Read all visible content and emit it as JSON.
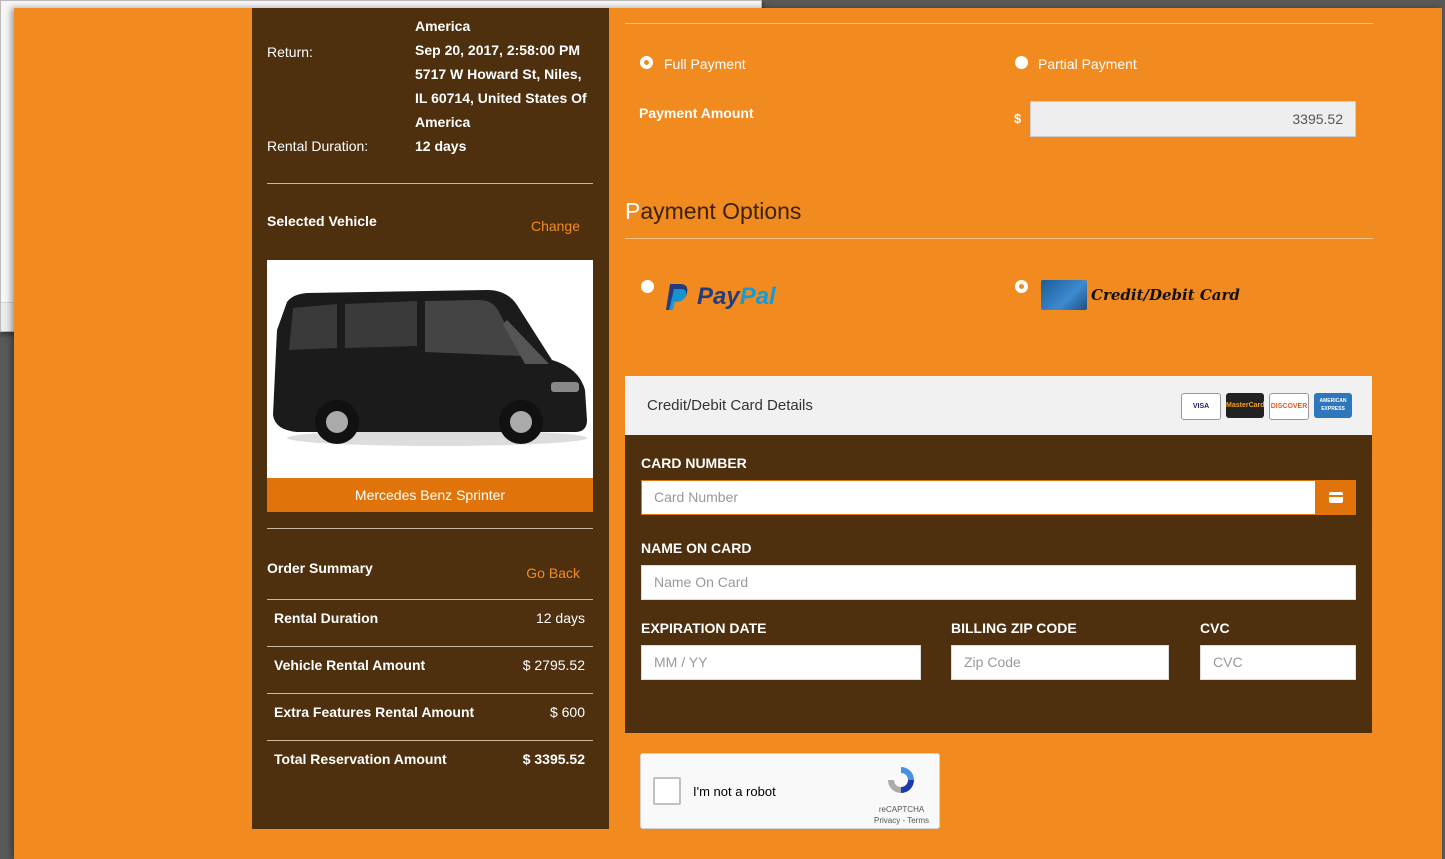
{
  "summary": {
    "pickup_tail": "America",
    "return_label": "Return:",
    "return_value": [
      "Sep 20, 2017, 2:58:00 PM",
      "5717 W Howard St, Niles,",
      "IL 60714, United States Of",
      "America"
    ],
    "duration_label": "Rental Duration:",
    "duration_value": "12 days",
    "selected_vehicle_label": "Selected Vehicle",
    "change_link": "Change",
    "vehicle_name": "Mercedes Benz Sprinter",
    "order_summary_label": "Order Summary",
    "go_back_link": "Go Back",
    "rows": [
      {
        "label": "Rental Duration",
        "value": "12 days"
      },
      {
        "label": "Vehicle Rental Amount",
        "value": "$ 2795.52"
      },
      {
        "label": "Extra Features Rental Amount",
        "value": "$ 600"
      },
      {
        "label": "Total Reservation Amount",
        "value": "$ 3395.52"
      }
    ]
  },
  "payment": {
    "full_payment": "Full Payment",
    "partial_payment": "Partial Payment",
    "amount_label": "Payment Amount",
    "currency": "$",
    "amount_value": "3395.52",
    "options_title_first": "P",
    "options_title_rest": "ayment Options",
    "paypal_pay": "Pay",
    "paypal_pal": "Pal",
    "card_option": "Credit/Debit Card"
  },
  "card_form": {
    "title": "Credit/Debit Card Details",
    "logos": [
      "VISA",
      "MasterCard",
      "DISCOVER",
      "AMERICAN EXPRESS"
    ],
    "card_number_label": "CARD NUMBER",
    "card_number_placeholder": "Card Number",
    "name_label": "NAME ON CARD",
    "name_placeholder": "Name On Card",
    "exp_label": "EXPIRATION DATE",
    "exp_placeholder": "MM  / YY",
    "zip_label": "BILLING ZIP CODE",
    "zip_placeholder": "Zip Code",
    "cvc_label": "CVC",
    "cvc_placeholder": "CVC"
  },
  "captcha": {
    "label": "I'm not a robot",
    "brand": "reCAPTCHA",
    "links": "Privacy - Terms"
  },
  "colors": {
    "orange": "#f18b1f",
    "brown": "#4e300f",
    "accent": "#e0740a"
  }
}
